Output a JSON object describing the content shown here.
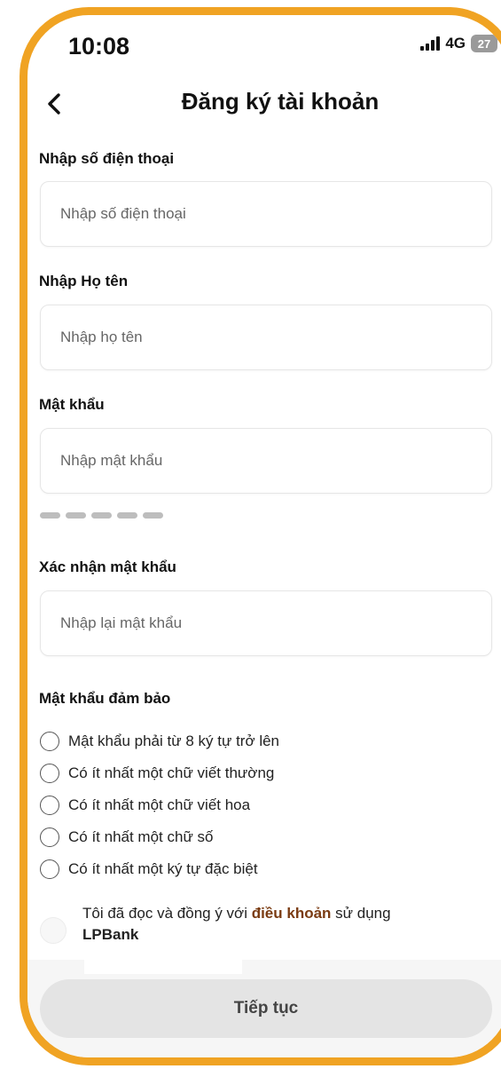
{
  "status_bar": {
    "time": "10:08",
    "network": "4G",
    "battery": "27"
  },
  "header": {
    "title": "Đăng ký tài khoản"
  },
  "fields": {
    "phone": {
      "label": "Nhập số điện thoại",
      "placeholder": "Nhập số điện thoại",
      "value": ""
    },
    "fullname": {
      "label": "Nhập Họ tên",
      "placeholder": "Nhập họ tên",
      "value": ""
    },
    "password": {
      "label": "Mật khẩu",
      "placeholder": "Nhập mật khẩu",
      "value": ""
    },
    "confirm_password": {
      "label": "Xác nhận mật khẩu",
      "placeholder": "Nhập lại mật khẩu",
      "value": ""
    }
  },
  "password_strength": {
    "filled_segments": 0,
    "total_segments": 5
  },
  "rules": {
    "title": "Mật khẩu đảm bảo",
    "items": [
      {
        "label": "Mật khẩu phải từ 8 ký tự trở lên",
        "checked": false
      },
      {
        "label": "Có ít nhất một chữ viết thường",
        "checked": false
      },
      {
        "label": "Có ít nhất một chữ viết hoa",
        "checked": false
      },
      {
        "label": "Có ít nhất một chữ số",
        "checked": false
      },
      {
        "label": "Có ít nhất một ký tự đặc biệt",
        "checked": false
      }
    ]
  },
  "terms": {
    "prefix": "Tôi đã đọc và đồng ý với ",
    "link_text": "điều khoản",
    "suffix": " sử dụng",
    "bank": "LPBank",
    "checked": false
  },
  "footer": {
    "continue_label": "Tiếp tục"
  },
  "colors": {
    "frame": "#f0a323",
    "link": "#7a3b12",
    "button_disabled": "#e4e4e4"
  }
}
